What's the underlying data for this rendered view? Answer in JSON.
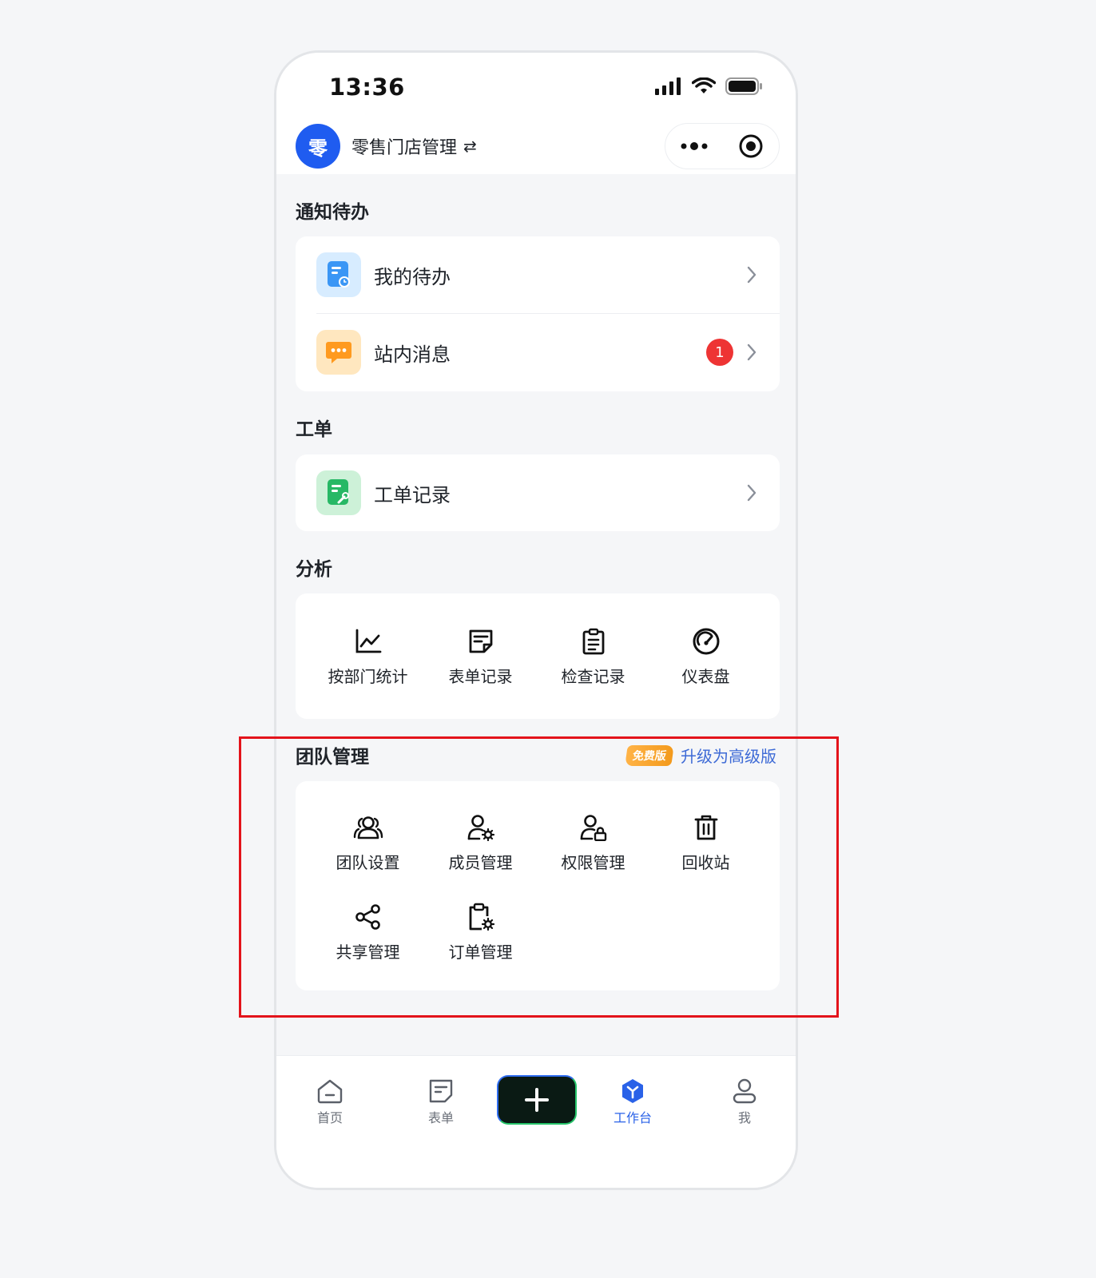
{
  "status_bar": {
    "time": "13:36"
  },
  "app": {
    "logo_char": "零",
    "title": "零售门店管理",
    "switch_glyph": "⇄"
  },
  "sections": {
    "notifications": {
      "title": "通知待办",
      "items": [
        {
          "label": "我的待办",
          "icon": "todo-icon"
        },
        {
          "label": "站内消息",
          "icon": "message-icon",
          "badge": "1"
        }
      ]
    },
    "workorder": {
      "title": "工单",
      "items": [
        {
          "label": "工单记录",
          "icon": "workorder-icon"
        }
      ]
    },
    "analysis": {
      "title": "分析",
      "items": [
        {
          "label": "按部门统计",
          "icon": "line-chart-icon"
        },
        {
          "label": "表单记录",
          "icon": "form-record-icon"
        },
        {
          "label": "检查记录",
          "icon": "checklist-icon"
        },
        {
          "label": "仪表盘",
          "icon": "dashboard-icon"
        }
      ]
    },
    "team": {
      "title": "团队管理",
      "free_tag": "免费版",
      "upgrade_link": "升级为高级版",
      "items": [
        {
          "label": "团队设置",
          "icon": "team-settings-icon"
        },
        {
          "label": "成员管理",
          "icon": "member-management-icon"
        },
        {
          "label": "权限管理",
          "icon": "permission-icon"
        },
        {
          "label": "回收站",
          "icon": "trash-icon"
        },
        {
          "label": "共享管理",
          "icon": "share-icon"
        },
        {
          "label": "订单管理",
          "icon": "order-management-icon"
        }
      ]
    }
  },
  "tabbar": {
    "items": [
      {
        "label": "首页",
        "icon": "home-icon",
        "active": false
      },
      {
        "label": "表单",
        "icon": "form-icon",
        "active": false
      },
      {
        "label": "",
        "icon": "plus-icon",
        "active": false
      },
      {
        "label": "工作台",
        "icon": "workbench-icon",
        "active": true
      },
      {
        "label": "我",
        "icon": "profile-icon",
        "active": false
      }
    ]
  },
  "colors": {
    "brand_blue": "#1f5cf0",
    "active_tab": "#2a62e8",
    "badge_red": "#ee3434",
    "highlight_red": "#e3131b",
    "upgrade_link": "#3d6ad6"
  }
}
